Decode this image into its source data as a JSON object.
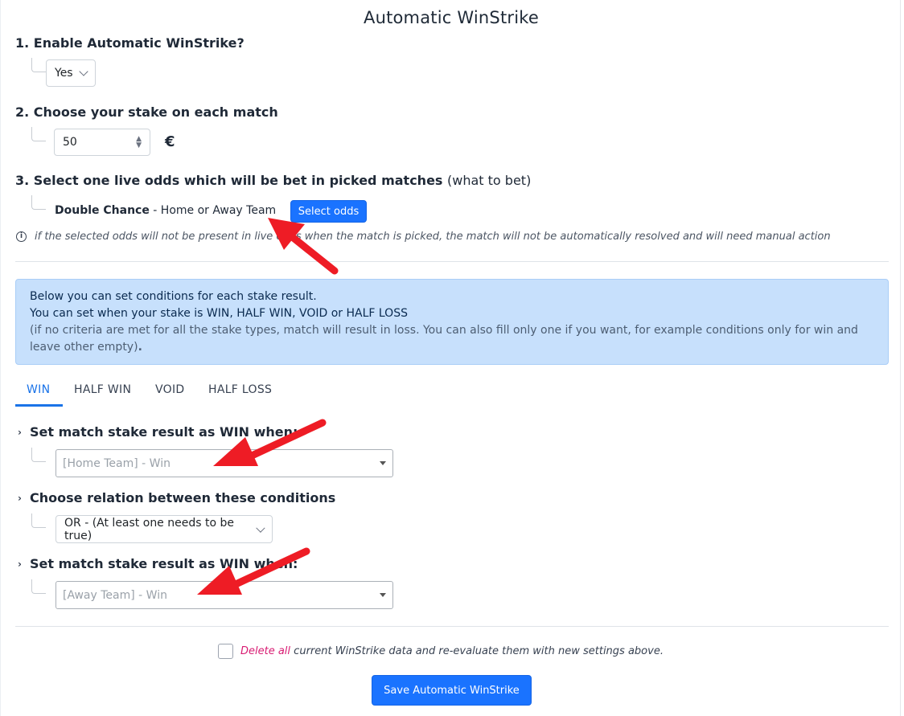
{
  "title": "Automatic WinStrike",
  "step1": {
    "label": "1. Enable Automatic WinStrike?",
    "select_value": "Yes"
  },
  "step2": {
    "label": "2. Choose your stake on each match",
    "stake_value": "50",
    "currency": "€"
  },
  "step3": {
    "label_bold": "3. Select one live odds which will be bet in picked matches",
    "label_normal": "(what to bet)",
    "odds_bold": "Double Chance",
    "odds_rest": " - Home or Away Team",
    "select_odds_button": "Select odds",
    "note": "if the selected odds will not be present in live odds when the match is picked, the match will not be automatically resolved and will need manual action"
  },
  "alert": {
    "line1": "Below you can set conditions for each stake result.",
    "line2": "You can set when your stake is WIN, HALF WIN, VOID or HALF LOSS",
    "line3_part1": "(if no criteria are met for all the stake types, match will result in loss. You can also fill only one if you want, for example conditions only for win and leave",
    "line3_part2": "other empty)",
    "line3_end": "."
  },
  "tabs": [
    {
      "label": "WIN",
      "active": true
    },
    {
      "label": "HALF WIN",
      "active": false
    },
    {
      "label": "VOID",
      "active": false
    },
    {
      "label": "HALF LOSS",
      "active": false
    }
  ],
  "conditions": {
    "first_heading": "Set match stake result as WIN when:",
    "first_value": "[Home Team] - Win",
    "relation_heading": "Choose relation between these conditions",
    "relation_value": "OR - (At least one needs to be true)",
    "second_heading": "Set match stake result as WIN when:",
    "second_value": "[Away Team] - Win"
  },
  "footer": {
    "delete_link": "Delete all",
    "delete_rest": " current WinStrike data and re-evaluate them with new settings above.",
    "save_button": "Save Automatic WinStrike"
  },
  "colors": {
    "primary": "#1a73ff",
    "alert_bg": "#c7e0fc",
    "arrow_red": "#ee1c25",
    "delete_pink": "#d81b72"
  }
}
